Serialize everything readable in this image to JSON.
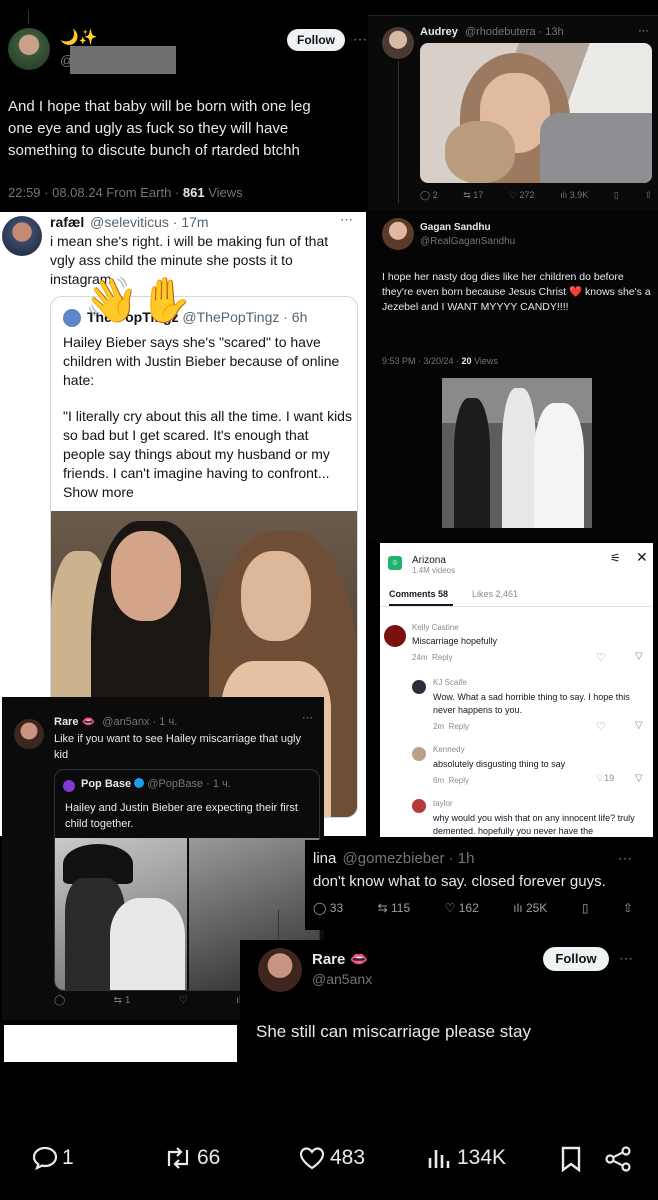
{
  "t1": {
    "emoji": "🌙✨",
    "handle": "@",
    "follow": "Follow",
    "text": "And I hope that baby will be born with one leg one eye and ugly as fuck so they will have something to discute bunch of rtarded btchh",
    "meta": "22:59 · 08.08.24 From Earth · ",
    "views_num": "861",
    "views_word": " Views"
  },
  "t2": {
    "name": "Audrey",
    "handle": "@rhodebutera · 13h",
    "replies": "2",
    "reposts": "17",
    "likes": "272",
    "views": "3.9K"
  },
  "t3": {
    "name": "rafæl",
    "handle": "@seleviticus · 17m",
    "text": "i mean she's right. i will be making fun of that vgly ass child the minute she posts it to instagram.",
    "quote_name": "The PopTingz",
    "quote_handle": "@ThePopTingz · 6h",
    "quote_text": "Hailey Bieber says she's \"scared\" to have children with Justin Bieber because of online hate:",
    "quote_text2": "\"I literally cry about this all the time. I want kids so bad but I get scared. It's enough that people say things about my husband or my friends. I can't imagine having to confront... Show more",
    "emoji_hands": "👋✋"
  },
  "t4": {
    "name": "Gagan Sandhu",
    "handle": "@RealGaganSandhu",
    "text": "I hope her nasty dog dies like her children do before they're even born because Jesus Christ ❤️ knows she's a Jezebel and I WANT MYYYY CANDY!!!!",
    "meta": "9:53 PM · 3/20/24 · ",
    "views_num": "20",
    "views_word": " Views"
  },
  "t5": {
    "title": "Arizona",
    "sub": "1.4M videos",
    "tab_comments": "Comments 58",
    "tab_likes": "Likes 2,461",
    "comments": [
      {
        "name": "Kelly Castine",
        "text": "Miscarriage hopefully",
        "time": "24m",
        "reply": "Reply",
        "likes": ""
      },
      {
        "name": "KJ Scaife",
        "text": "Wow. What a sad horrible thing to say. I hope this never happens to you.",
        "time": "2m",
        "reply": "Reply",
        "likes": ""
      },
      {
        "name": "Kennedy",
        "text": "absolutely disgusting thing to say",
        "time": "6m",
        "reply": "Reply",
        "likes": "19"
      },
      {
        "name": "taylor",
        "text": "why would you wish that on any innocent life? truly demented. hopefully you never have the",
        "time": "",
        "reply": "",
        "likes": ""
      }
    ]
  },
  "t6": {
    "name": "Rare 👄",
    "handle": "@an5anx · 1 ч.",
    "text": "Like if you want to see Hailey miscarriage that ugly kid",
    "quote_name": "Pop Base",
    "quote_handle": "@PopBase · 1 ч.",
    "quote_text": "Hailey and Justin Bieber are expecting their first child together.",
    "reposts": "1"
  },
  "t7": {
    "name": "lina",
    "handle": "@gomezbieber · 1h",
    "text": "don't know what to say. closed forever guys.",
    "replies": "33",
    "reposts": "115",
    "likes": "162",
    "views": "25K"
  },
  "t8": {
    "name": "Rare 👄",
    "handle": "@an5anx",
    "follow": "Follow",
    "text": "She still can miscarriage please stay"
  },
  "bar": {
    "replies": "1",
    "reposts": "66",
    "likes": "483",
    "views": "134K"
  }
}
